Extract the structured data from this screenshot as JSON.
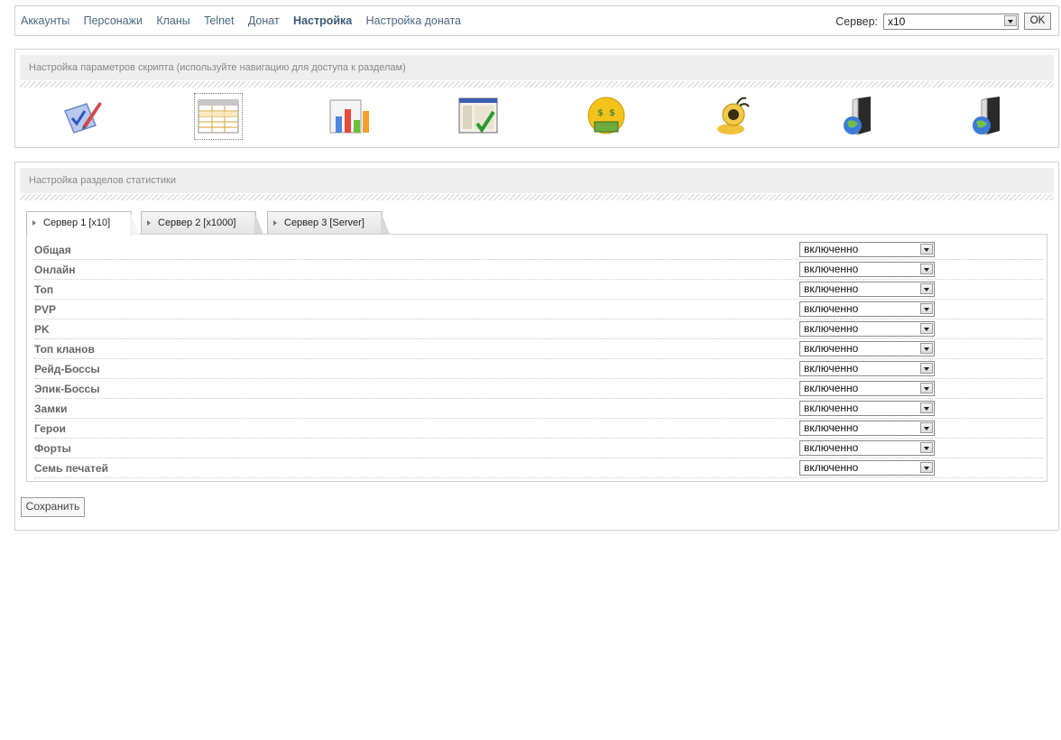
{
  "nav": {
    "items": [
      "Аккаунты",
      "Персонажи",
      "Кланы",
      "Telnet",
      "Донат",
      "Настройка",
      "Настройка доната"
    ],
    "active_index": 5
  },
  "server": {
    "label": "Сервер:",
    "selected": "x10",
    "ok_label": "OK"
  },
  "settings_panel": {
    "title": "Настройка параметров скрипта (используйте навигацию для доступа к разделам)",
    "icons": [
      "checklist-pen-icon",
      "table-grid-icon",
      "bar-chart-icon",
      "browser-check-icon",
      "money-smiley-icon",
      "chat-bee-icon",
      "server-globe-icon",
      "server-globe-icon"
    ],
    "selected_icon": 1
  },
  "stats_panel": {
    "title": "Настройка разделов статистики",
    "tabs": [
      "Сервер 1 [x10]",
      "Сервер 2 [x1000]",
      "Сервер 3 [Server]"
    ],
    "active_tab": 0,
    "rows": [
      {
        "label": "Общая",
        "value": "включенно"
      },
      {
        "label": "Онлайн",
        "value": "включенно"
      },
      {
        "label": "Топ",
        "value": "включенно"
      },
      {
        "label": "PVP",
        "value": "включенно"
      },
      {
        "label": "PK",
        "value": "включенно"
      },
      {
        "label": "Топ кланов",
        "value": "включенно"
      },
      {
        "label": "Рейд-Боссы",
        "value": "включенно"
      },
      {
        "label": "Эпик-Боссы",
        "value": "включенно"
      },
      {
        "label": "Замки",
        "value": "включенно"
      },
      {
        "label": "Герои",
        "value": "включенно"
      },
      {
        "label": "Форты",
        "value": "включенно"
      },
      {
        "label": "Семь печатей",
        "value": "включенно"
      }
    ],
    "save_label": "Сохранить"
  }
}
